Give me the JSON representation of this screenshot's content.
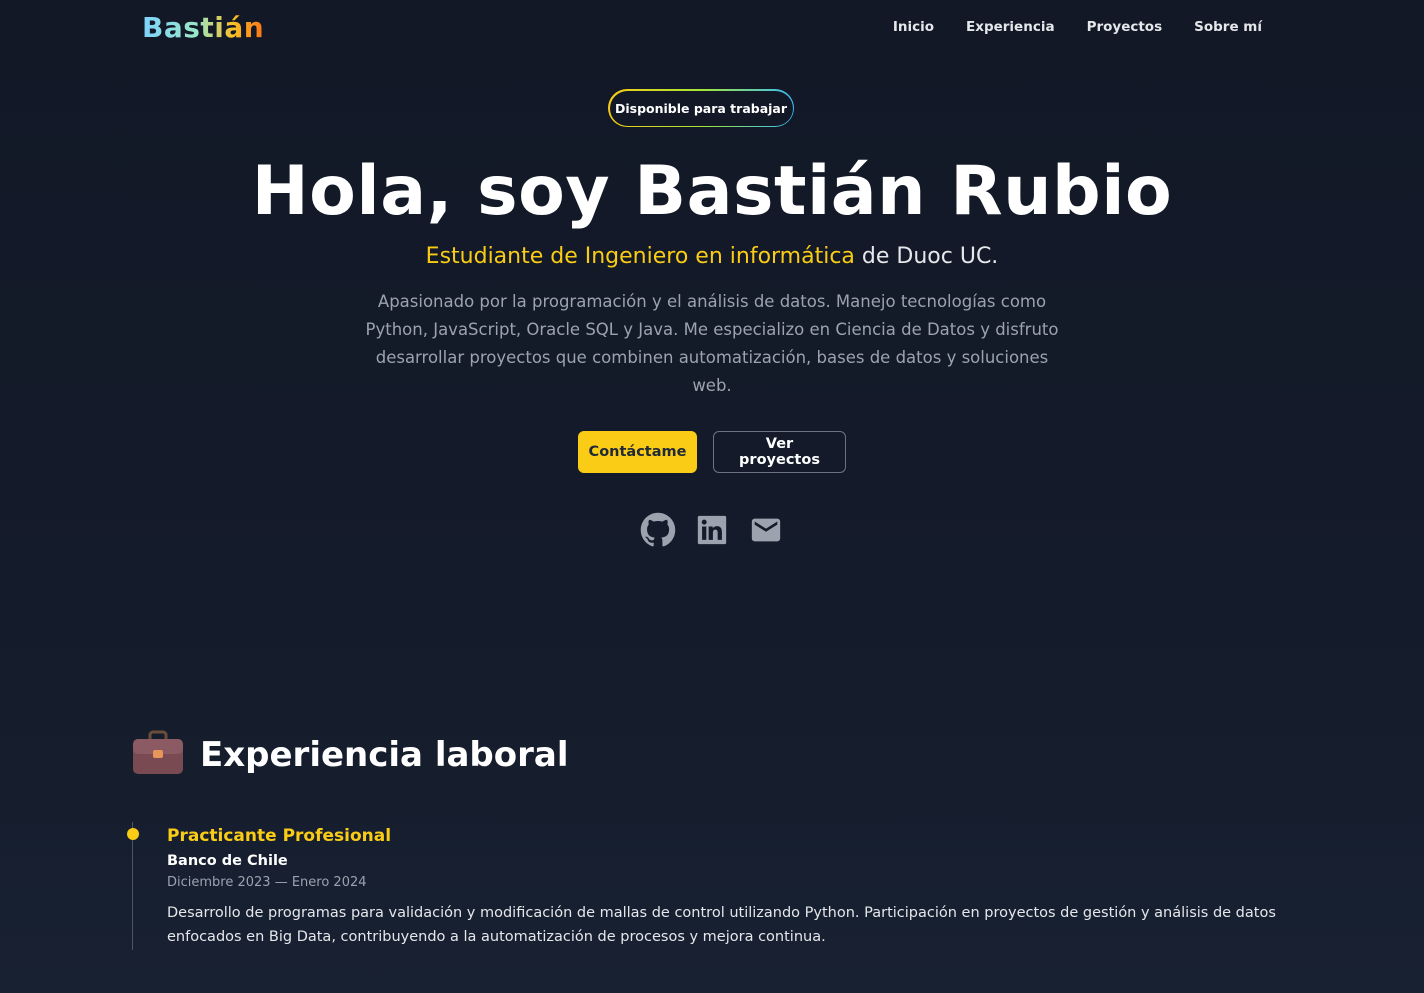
{
  "nav": {
    "logo": "Bastián",
    "links": [
      "Inicio",
      "Experiencia",
      "Proyectos",
      "Sobre mí"
    ]
  },
  "hero": {
    "badge": "Disponible para trabajar",
    "title": "Hola, soy Bastián Rubio",
    "subtitle_accent": "Estudiante de Ingeniero en informática",
    "subtitle_rest": " de Duoc UC.",
    "description": "Apasionado por la programación y el análisis de datos. Manejo tecnologías como Python, JavaScript, Oracle SQL y Java. Me especializo en Ciencia de Datos y disfruto desarrollar proyectos que combinen automatización, bases de datos y soluciones web.",
    "primary_button": "Contáctame",
    "secondary_button": "Ver proyectos",
    "socials": [
      "github-icon",
      "linkedin-icon",
      "mail-icon"
    ]
  },
  "experience": {
    "icon": "briefcase-icon",
    "title": "Experiencia laboral",
    "jobs": [
      {
        "role": "Practicante Profesional",
        "company": "Banco de Chile",
        "dates": "Diciembre 2023 — Enero 2024",
        "description": "Desarrollo de programas para validación y modificación de mallas de control utilizando Python. Participación en proyectos de gestión y análisis de datos enfocados en Big Data, contribuyendo a la automatización de procesos y mejora continua."
      }
    ]
  },
  "colors": {
    "background": "#121826",
    "accent": "#facc15",
    "text": "#e5e7eb",
    "muted": "#9ca3af"
  }
}
